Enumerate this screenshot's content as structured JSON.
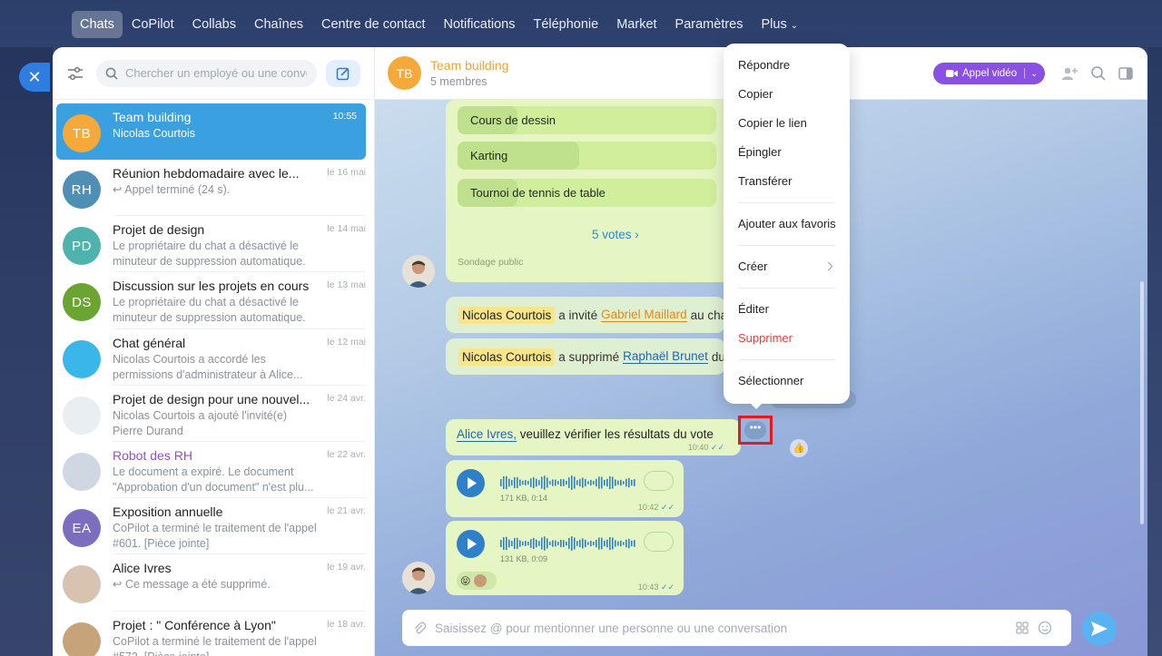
{
  "topnav": [
    "Chats",
    "CoPilot",
    "Collabs",
    "Chaînes",
    "Centre de contact",
    "Notifications",
    "Téléphonie",
    "Market",
    "Paramètres",
    "Plus"
  ],
  "sidebar": {
    "search_placeholder": "Chercher un employé ou une conve",
    "chats": [
      {
        "initials": "TB",
        "color": "#f5a93b",
        "title": "Team building",
        "time": "10:55",
        "sub": "Nicolas Courtois"
      },
      {
        "initials": "RH",
        "color": "#4f8fb5",
        "title": "Réunion hebdomadaire avec le...",
        "time": "le 16 mai",
        "sub": "↩ Appel terminé (24 s)."
      },
      {
        "initials": "PD",
        "color": "#4fb3ad",
        "title": "Projet de design",
        "time": "le 14 mai",
        "sub": "Le propriétaire du chat a désactivé le minuteur de suppression automatique."
      },
      {
        "initials": "DS",
        "color": "#6aa531",
        "title": "Discussion sur les projets en cours",
        "time": "le 13 mai",
        "sub": "Le propriétaire du chat a désactivé le minuteur de suppression automatique."
      },
      {
        "initials": "",
        "color": "#3ab7e8",
        "title": "Chat général",
        "time": "le 12 mai",
        "sub": "Nicolas Courtois a accordé les permissions d'administrateur à Alice..."
      },
      {
        "initials": "",
        "color": "#e9eef2",
        "title": "Projet de design pour une nouvel...",
        "time": "le 24 avr.",
        "sub": "Nicolas Courtois a ajouté l'invité(e) Pierre Durand"
      },
      {
        "initials": "",
        "color": "#cfd7e3",
        "title": "Robot des RH",
        "time": "le 22 avr.",
        "sub": "Le document a expiré. Le document \"Approbation d'un document\" n'est plu..."
      },
      {
        "initials": "EA",
        "color": "#7d6dbf",
        "title": "Exposition annuelle",
        "time": "le 21 avr.",
        "sub": "CoPilot a terminé le traitement de l'appel #601. [Pièce jointe]"
      },
      {
        "initials": "",
        "color": "#d8c3b0",
        "title": "Alice Ivres",
        "time": "le 19 avr.",
        "sub": "↩ Ce message a été supprimé."
      },
      {
        "initials": "",
        "color": "#c7a37a",
        "title": "Projet : \" Conférence à Lyon\"",
        "time": "le 18 avr.",
        "sub": "CoPilot a terminé le traitement de l'appel #573. [Pièce jointe]"
      }
    ]
  },
  "header": {
    "initials": "TB",
    "title": "Team building",
    "subtitle": "5 membres",
    "video_label": "Appel vidéo"
  },
  "poll": {
    "options": [
      "Cours de dessin",
      "Karting",
      "Tournoi de tennis de table"
    ],
    "fills": [
      0.23,
      0.47,
      0.23
    ],
    "votes": "5 votes",
    "footer": "Sondage public"
  },
  "system_messages": [
    {
      "actor": "Nicolas Courtois",
      "verb": "a invité",
      "target": "Gabriel Maillard",
      "tail": "au cha"
    },
    {
      "actor": "Nicolas Courtois",
      "verb": "a supprimé",
      "target": "Raphaël Brunet",
      "tail": "du"
    }
  ],
  "vote_message": {
    "mention": "Alice Ivres,",
    "text": "veuillez vérifier les résultats du vote",
    "time": "10:40"
  },
  "voice_messages": [
    {
      "size": "171 KB, 0:14",
      "time": "10:42"
    },
    {
      "size": "131 KB, 0:09",
      "time": "10:43"
    }
  ],
  "composer": {
    "placeholder": "Saisissez @ pour mentionner une personne ou une conversation"
  },
  "context_menu": {
    "group1": [
      "Répondre",
      "Copier",
      "Copier le lien",
      "Épingler",
      "Transférer"
    ],
    "group2": [
      "Ajouter aux favoris"
    ],
    "group3": [
      "Créer"
    ],
    "group4": [
      "Éditer",
      "Supprimer"
    ],
    "group5": [
      "Sélectionner"
    ]
  }
}
